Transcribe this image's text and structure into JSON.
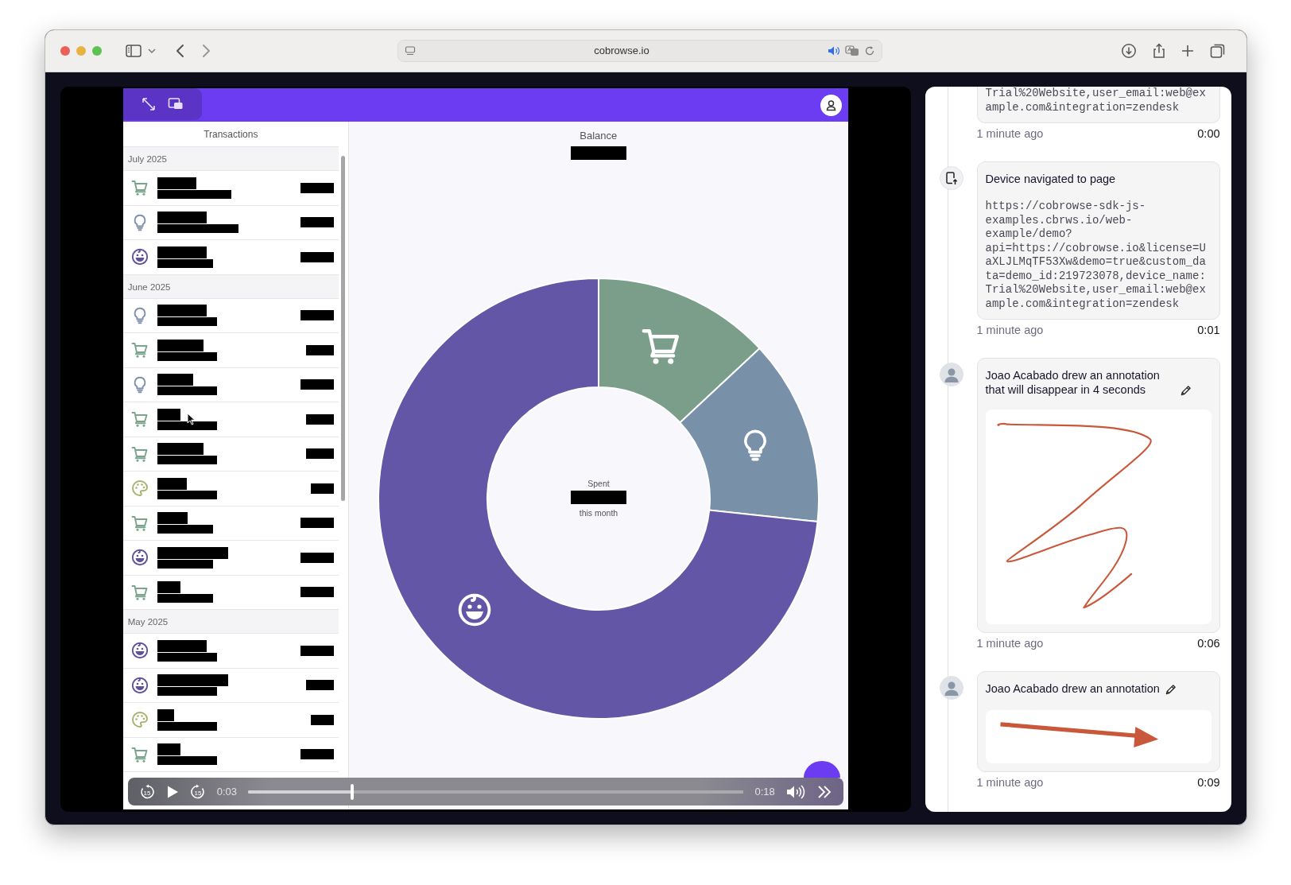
{
  "browser": {
    "address": "cobrowse.io"
  },
  "player": {
    "transactions": {
      "title": "Transactions",
      "groups": [
        {
          "label": "July 2025",
          "items": [
            {
              "kind": "cart"
            },
            {
              "kind": "bulb"
            },
            {
              "kind": "face"
            }
          ]
        },
        {
          "label": "June 2025",
          "items": [
            {
              "kind": "bulb"
            },
            {
              "kind": "cart"
            },
            {
              "kind": "bulb"
            },
            {
              "kind": "cart"
            },
            {
              "kind": "cart"
            },
            {
              "kind": "palette"
            },
            {
              "kind": "cart"
            },
            {
              "kind": "face"
            },
            {
              "kind": "cart"
            }
          ]
        },
        {
          "label": "May 2025",
          "items": [
            {
              "kind": "face"
            },
            {
              "kind": "face"
            },
            {
              "kind": "palette"
            },
            {
              "kind": "cart"
            }
          ]
        }
      ]
    },
    "balance": {
      "title": "Balance",
      "center_label": "Spent",
      "center_sublabel": "this month",
      "segments": [
        {
          "kind": "cart",
          "color": "#7a9e8a"
        },
        {
          "kind": "bulb",
          "color": "#7890a8"
        },
        {
          "kind": "face",
          "color": "#6356a6"
        }
      ]
    },
    "controls": {
      "skip_back": "15",
      "skip_forward": "15",
      "elapsed": "0:03",
      "duration": "0:18",
      "level": 0.21
    }
  },
  "timeline": [
    {
      "kind": "url",
      "url": "Trial%20Website,user_email:web@example.com&integration=zendesk",
      "time_ago": "1 minute ago",
      "timestamp": "0:00"
    },
    {
      "kind": "navigation",
      "title": "Device navigated to page",
      "url": "https://cobrowse-sdk-js-examples.cbrws.io/web-example/demo?api=https://cobrowse.io&license=UaXLJLMqTF53Xw&demo=true&custom_data=demo_id:219723078,device_name:Trial%20Website,user_email:web@example.com&integration=zendesk",
      "time_ago": "1 minute ago",
      "timestamp": "0:01"
    },
    {
      "kind": "zigzag_annotation",
      "title": "Joao Acabado drew an annotation that will disappear in 4 seconds",
      "time_ago": "1 minute ago",
      "timestamp": "0:06"
    },
    {
      "kind": "arrow_annotation",
      "title": "Joao Acabado drew an annotation",
      "time_ago": "1 minute ago",
      "timestamp": "0:09"
    }
  ]
}
